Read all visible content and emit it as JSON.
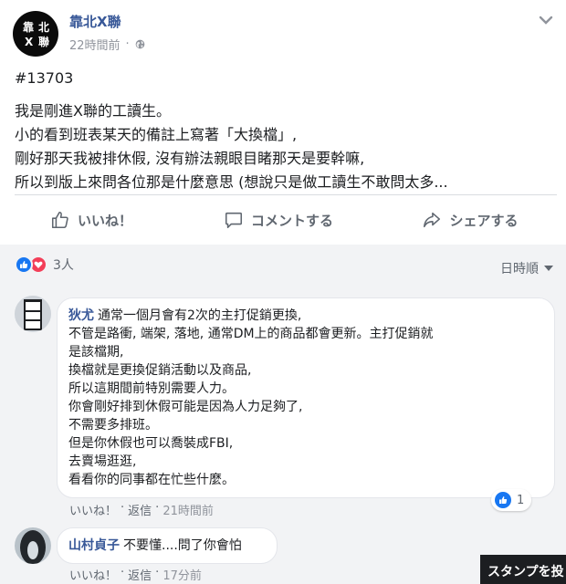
{
  "post": {
    "page_name": "靠北X聯",
    "avatar_chars": [
      "靠",
      "北",
      "X",
      "聯"
    ],
    "timestamp": "22時間前",
    "separator": "·",
    "hashtag": "#13703",
    "lines": [
      "我是剛進X聯的工讀生。",
      "小的看到班表某天的備註上寫著「大換檔」,",
      "剛好那天我被排休假, 沒有辦法親眼目睹那天是要幹嘛,",
      "所以到版上來問各位那是什麼意思 (想說只是做工讀生不敢問太多..."
    ]
  },
  "actions": {
    "like": "いいね！",
    "comment": "コメントする",
    "share": "シェアする"
  },
  "reactions": {
    "count": "3人"
  },
  "sort": {
    "label": "日時順"
  },
  "comments": [
    {
      "author": "狄尤",
      "lines": [
        "通常一個月會有2次的主打促銷更換,",
        "不管是路衝, 端架, 落地, 通常DM上的商品都會更新。主打促銷就",
        "是該檔期,",
        "換檔就是更換促銷活動以及商品,",
        "所以這期間前特別需要人力。",
        "你會剛好排到休假可能是因為人力足夠了,",
        "不需要多排班。",
        "但是你休假也可以喬裝成FBI,",
        "去賣場逛逛,",
        "看看你的同事都在忙些什麼。"
      ],
      "like": "いいね！",
      "reply": "返信",
      "time": "21時間前",
      "reaction_count": "1",
      "avatar_text": [
        "工",
        "讀",
        "生"
      ]
    },
    {
      "author": "山村貞子",
      "text": "不要懂....問了你會怕",
      "like": "いいね！",
      "reply": "返信",
      "time": "17分前"
    }
  ],
  "sticker_tooltip": "スタンプを投",
  "colors": {
    "link_blue": "#385898",
    "like_blue": "#1877f2",
    "love_red": "#f33e58",
    "panel_gray": "#f2f3f5"
  }
}
